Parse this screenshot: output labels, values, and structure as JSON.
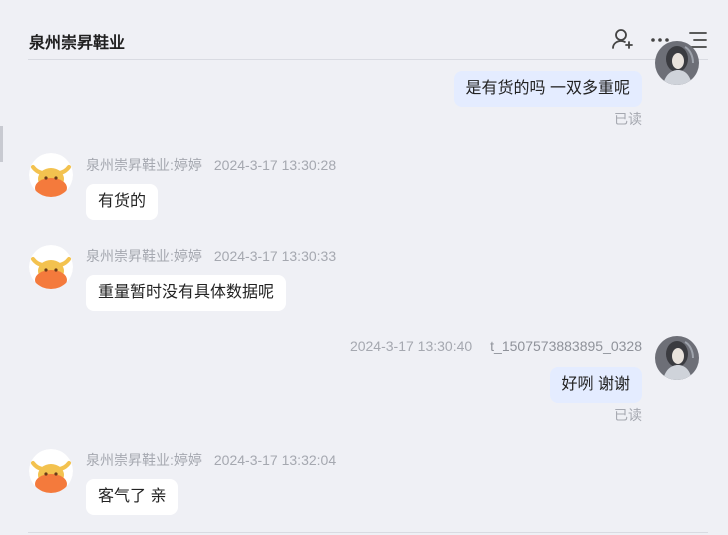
{
  "header": {
    "title": "泉州崇昇鞋业",
    "add_contact_icon": "add-contact-icon",
    "more_icon": "more-icon",
    "menu_icon": "menu-icon"
  },
  "messages": [
    {
      "direction": "out",
      "text": "是有货的吗 一双多重呢",
      "status": "已读"
    },
    {
      "direction": "in",
      "sender": "泉州崇昇鞋业:婷婷",
      "time": "2024-3-17 13:30:28",
      "text": "有货的"
    },
    {
      "direction": "in",
      "sender": "泉州崇昇鞋业:婷婷",
      "time": "2024-3-17 13:30:33",
      "text": "重量暂时没有具体数据呢"
    },
    {
      "direction": "out",
      "sender": "t_1507573883895_0328",
      "time": "2024-3-17 13:30:40",
      "text": "好咧 谢谢",
      "status": "已读"
    },
    {
      "direction": "in",
      "sender": "泉州崇昇鞋业:婷婷",
      "time": "2024-3-17 13:32:04",
      "text": "客气了 亲"
    }
  ],
  "colors": {
    "background": "#eff0f5",
    "incoming_bubble": "#ffffff",
    "outgoing_bubble": "#e4ecff",
    "meta_text": "#a5a8b0",
    "avatar_orange": "#f47a3c",
    "avatar_horn": "#f3c24f"
  }
}
